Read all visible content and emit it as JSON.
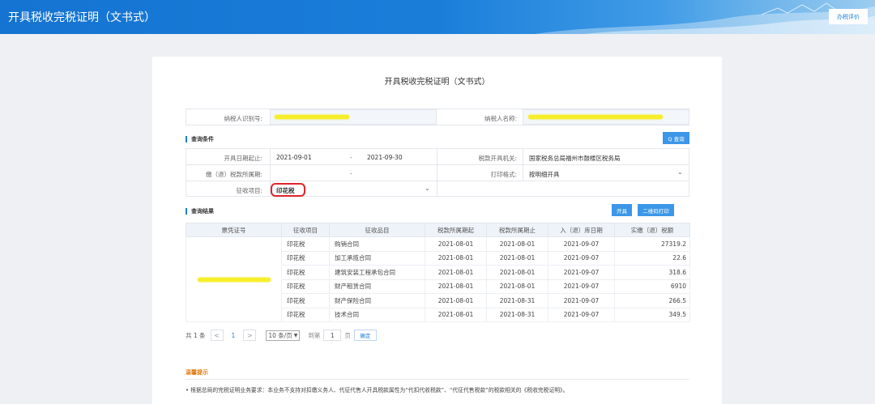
{
  "header": {
    "app_title": "开具税收完税证明（文书式）",
    "eval_button": "办税评价"
  },
  "page_title": "开具税收完税证明（文书式）",
  "taxpayer": {
    "id_label": "纳税人识别号:",
    "name_label": "纳税人名称:"
  },
  "query": {
    "section_title": "查询条件",
    "search_button": "Q 查询",
    "date_label": "开具日期起止:",
    "date_from": "2021-09-01",
    "date_sep": "-",
    "date_to": "2021-09-30",
    "issuer_label": "税款开具机关:",
    "issuer_value": "国家税务总局福州市鼓楼区税务局",
    "period_label": "缴（退）税款所属期:",
    "period_sep": "-",
    "print_label": "打印格式:",
    "print_value": "按明细开具",
    "item_label": "征收项目:",
    "item_value": "印花税"
  },
  "results": {
    "section_title": "查询结果",
    "open_button": "开具",
    "qr_button": "二维码打印",
    "columns": [
      "票凭证号",
      "征收项目",
      "征收品目",
      "税款所属期起",
      "税款所属期止",
      "入（退）库日期",
      "实缴（退）税额"
    ],
    "rows": [
      {
        "item": "印花税",
        "subitem": "购销合同",
        "from": "2021-08-01",
        "to": "2021-08-01",
        "date": "2021-09-07",
        "amount": "27319.2"
      },
      {
        "item": "印花税",
        "subitem": "加工承揽合同",
        "from": "2021-08-01",
        "to": "2021-08-01",
        "date": "2021-09-07",
        "amount": "22.6"
      },
      {
        "item": "印花税",
        "subitem": "建筑安装工程承包合同",
        "from": "2021-08-01",
        "to": "2021-08-01",
        "date": "2021-09-07",
        "amount": "318.6"
      },
      {
        "item": "印花税",
        "subitem": "财产租赁合同",
        "from": "2021-08-01",
        "to": "2021-08-01",
        "date": "2021-09-07",
        "amount": "6910"
      },
      {
        "item": "印花税",
        "subitem": "财产保险合同",
        "from": "2021-08-01",
        "to": "2021-08-31",
        "date": "2021-09-07",
        "amount": "266.5"
      },
      {
        "item": "印花税",
        "subitem": "技术合同",
        "from": "2021-08-01",
        "to": "2021-08-31",
        "date": "2021-09-07",
        "amount": "349.5"
      }
    ]
  },
  "pager": {
    "total": "共 1 条",
    "prev": "<",
    "current": "1",
    "next": ">",
    "page_size": "10 条/页",
    "goto_label": "到第",
    "goto_value": "1",
    "page_unit": "页",
    "ok": "确定"
  },
  "tips": {
    "title": "温馨提示",
    "text": "• 根据总局的完税证明业务要求：本业务不支持对扣缴义务人、代征代售人开具税款属性为“代扣代收税款”、“代征代售税款”的税款相关的《税收完税证明》。"
  },
  "colors": {
    "accent": "#1a7ed9",
    "highlight": "#f7ee2a",
    "circle": "#e0242b",
    "tips_title": "#e07a10"
  }
}
